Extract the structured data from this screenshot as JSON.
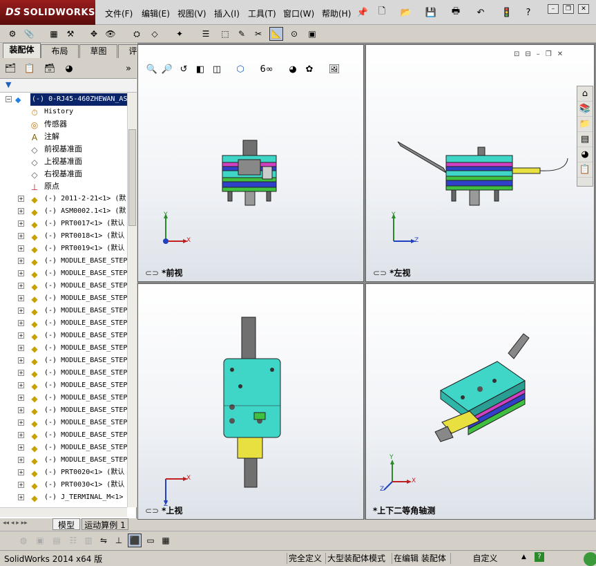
{
  "app": {
    "brand": "SOLIDWORKS",
    "brand_prefix": "DS"
  },
  "menu": [
    "文件(F)",
    "编辑(E)",
    "视图(V)",
    "插入(I)",
    "工具(T)",
    "窗口(W)",
    "帮助(H)"
  ],
  "tabs": [
    "装配体",
    "布局",
    "草图",
    "评估"
  ],
  "tree": {
    "root": "(-) 0-RJ45-460ZHEWAN_AS",
    "items": [
      {
        "label": "History",
        "icon": "history-icon",
        "expandable": false
      },
      {
        "label": "传感器",
        "icon": "sensor-icon",
        "expandable": false
      },
      {
        "label": "注解",
        "icon": "annotation-icon",
        "expandable": false
      },
      {
        "label": "前视基准面",
        "icon": "plane-icon",
        "expandable": false
      },
      {
        "label": "上视基准面",
        "icon": "plane-icon",
        "expandable": false
      },
      {
        "label": "右视基准面",
        "icon": "plane-icon",
        "expandable": false
      },
      {
        "label": "原点",
        "icon": "origin-icon",
        "expandable": false
      },
      {
        "label": "(-) 2011-2-21<1> (默",
        "icon": "subassembly-icon",
        "expandable": true
      },
      {
        "label": "(-) ASM0002.1<1> (默",
        "icon": "subassembly-icon",
        "expandable": true
      },
      {
        "label": "(-) PRT0017<1> (默认",
        "icon": "part-icon",
        "expandable": true
      },
      {
        "label": "(-) PRT0018<1> (默认",
        "icon": "part-icon",
        "expandable": true
      },
      {
        "label": "(-) PRT0019<1> (默认",
        "icon": "part-icon",
        "expandable": true
      },
      {
        "label": "(-) MODULE_BASE_STEP",
        "icon": "subassembly-icon",
        "expandable": true
      },
      {
        "label": "(-) MODULE_BASE_STEP",
        "icon": "subassembly-icon",
        "expandable": true
      },
      {
        "label": "(-) MODULE_BASE_STEP",
        "icon": "subassembly-icon",
        "expandable": true
      },
      {
        "label": "(-) MODULE_BASE_STEP",
        "icon": "subassembly-icon",
        "expandable": true
      },
      {
        "label": "(-) MODULE_BASE_STEP",
        "icon": "subassembly-icon",
        "expandable": true
      },
      {
        "label": "(-) MODULE_BASE_STEP",
        "icon": "subassembly-icon",
        "expandable": true
      },
      {
        "label": "(-) MODULE_BASE_STEP",
        "icon": "subassembly-icon",
        "expandable": true
      },
      {
        "label": "(-) MODULE_BASE_STEP",
        "icon": "subassembly-icon",
        "expandable": true
      },
      {
        "label": "(-) MODULE_BASE_STEP",
        "icon": "subassembly-icon",
        "expandable": true
      },
      {
        "label": "(-) MODULE_BASE_STEP",
        "icon": "subassembly-icon",
        "expandable": true
      },
      {
        "label": "(-) MODULE_BASE_STEP",
        "icon": "subassembly-icon",
        "expandable": true
      },
      {
        "label": "(-) MODULE_BASE_STEP",
        "icon": "subassembly-icon",
        "expandable": true
      },
      {
        "label": "(-) MODULE_BASE_STEP",
        "icon": "subassembly-icon",
        "expandable": true
      },
      {
        "label": "(-) MODULE_BASE_STEP",
        "icon": "subassembly-icon",
        "expandable": true
      },
      {
        "label": "(-) MODULE_BASE_STEP",
        "icon": "subassembly-icon",
        "expandable": true
      },
      {
        "label": "(-) MODULE_BASE_STEP",
        "icon": "subassembly-icon",
        "expandable": true
      },
      {
        "label": "(-) MODULE_BASE_STEP",
        "icon": "subassembly-icon",
        "expandable": true
      },
      {
        "label": "(-) PRT0020<1> (默认",
        "icon": "part-icon",
        "expandable": true
      },
      {
        "label": "(-) PRT0030<1> (默认",
        "icon": "part-icon",
        "expandable": true
      },
      {
        "label": "(-) J_TERMINAL_M<1>",
        "icon": "subassembly-icon",
        "expandable": true
      }
    ]
  },
  "bottom_tabs": [
    "模型",
    "运动算例 1"
  ],
  "viewports": {
    "front": "*前视",
    "left": "*左视",
    "top": "*上视",
    "iso": "*上下二等角轴测"
  },
  "axes": {
    "x": "X",
    "y": "Y",
    "z": "Z"
  },
  "status": {
    "version": "SolidWorks 2014 x64 版",
    "definition": "完全定义",
    "mode": "大型装配体模式",
    "editing": "在编辑 装配体",
    "units": "自定义"
  },
  "colors": {
    "brand_red": "#8b1a1a",
    "selection": "#0a246a",
    "model_cyan": "#3fd6c8",
    "model_yellow": "#e8e040",
    "model_magenta": "#d040c0",
    "model_blue": "#3040c8",
    "model_green": "#40c040"
  }
}
